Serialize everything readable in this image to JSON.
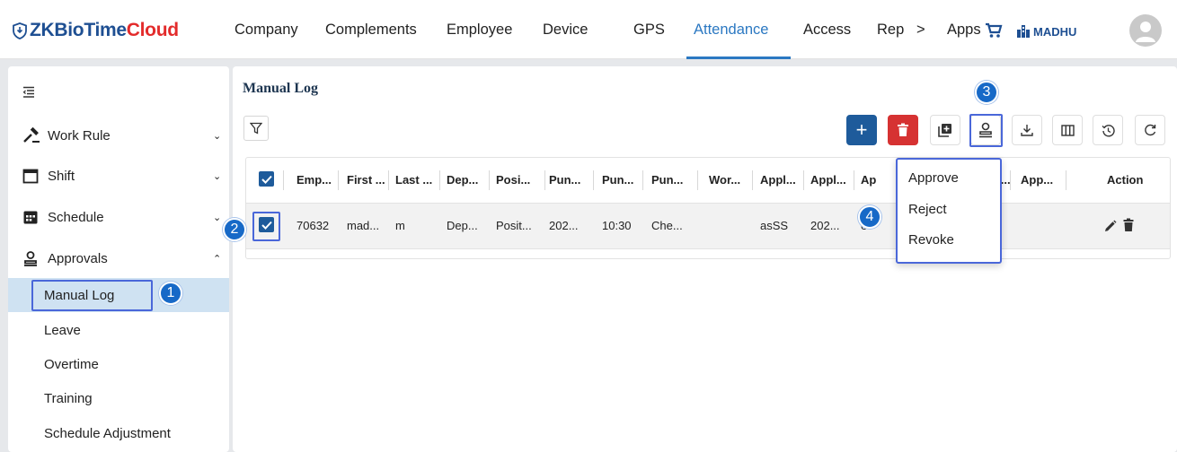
{
  "brand": {
    "zk": "ZK",
    "biotime": "BioTime",
    "cloud": "Cloud"
  },
  "nav": {
    "items": [
      "Company",
      "Complements",
      "Employee",
      "Device",
      "GPS",
      "Attendance",
      "Access",
      "Rep",
      ">",
      "Apps"
    ],
    "active": "Attendance",
    "company": "MADHU"
  },
  "sidebar": {
    "items": [
      {
        "label": "Work Rule",
        "icon": "gavel-icon",
        "expanded": false
      },
      {
        "label": "Shift",
        "icon": "calendar-icon",
        "expanded": false
      },
      {
        "label": "Schedule",
        "icon": "schedule-icon",
        "expanded": false
      },
      {
        "label": "Approvals",
        "icon": "approval-icon",
        "expanded": true
      }
    ],
    "subitems": [
      "Manual Log",
      "Leave",
      "Overtime",
      "Training",
      "Schedule Adjustment"
    ],
    "active_sub": "Manual Log"
  },
  "page": {
    "title": "Manual Log"
  },
  "table": {
    "headers": [
      "Emp...",
      "First ...",
      "Last ...",
      "Dep...",
      "Posi...",
      "Pun...",
      "Pun...",
      "Pun...",
      "Wor...",
      "Appl...",
      "Appl...",
      "Ap",
      "...o...",
      "App...",
      "Action"
    ],
    "row": [
      "70632",
      "mad...",
      "m",
      "Dep...",
      "Posit...",
      "202...",
      "10:30",
      "Che...",
      "",
      "asSS",
      "202...",
      "e"
    ]
  },
  "menu": {
    "items": [
      "Approve",
      "Reject",
      "Revoke"
    ]
  },
  "badges": [
    "1",
    "2",
    "3",
    "4"
  ],
  "colors": {
    "primary": "#1e5b9b",
    "danger": "#d63232",
    "accent": "#2b78c2",
    "highlight": "#4a67d9",
    "badge": "#1769c7"
  }
}
